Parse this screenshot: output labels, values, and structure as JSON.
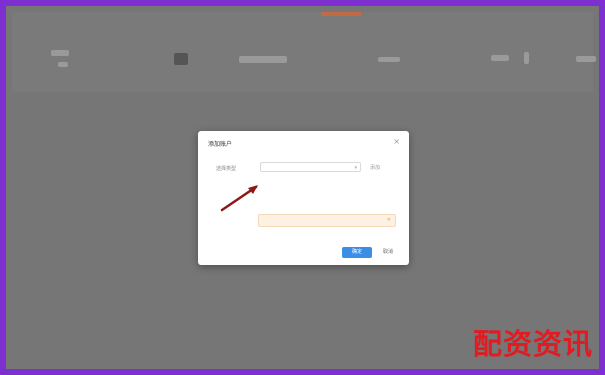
{
  "background": {
    "labels": [
      "",
      "",
      "",
      ""
    ]
  },
  "dialog": {
    "title": "添加账户",
    "close_glyph": "×",
    "row1_label": "选择类型",
    "select_value": "",
    "select_chevron": "▾",
    "side_link": "添加",
    "row2_label": "",
    "hint": "",
    "sub_option": "",
    "warning": "",
    "warning_icon": "✕",
    "confirm_label": "确定",
    "cancel_label": "取消"
  },
  "watermark": {
    "text": "配资资讯"
  },
  "colors": {
    "frame": "#7d2fd0",
    "overlay": "#767676",
    "primary": "#3a8ee6",
    "warning_bg": "#fdf1e4",
    "arrow": "#8b1a1a",
    "watermark": "#e11b22"
  }
}
